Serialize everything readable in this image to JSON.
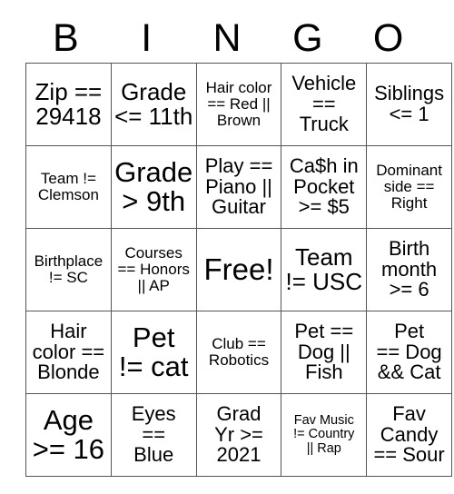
{
  "card": {
    "title_letters": [
      "B",
      "I",
      "N",
      "G",
      "O"
    ],
    "columns": 5,
    "rows": 5,
    "free_space": {
      "row": 2,
      "col": 2,
      "label": "Free!"
    },
    "cells": [
      [
        {
          "text": "Zip ==\n29418",
          "size": "lg"
        },
        {
          "text": "Grade\n<= 11th",
          "size": "lg"
        },
        {
          "text": "Hair color\n== Red ||\nBrown",
          "size": "sm"
        },
        {
          "text": "Vehicle\n==\nTruck",
          "size": "md"
        },
        {
          "text": "Siblings\n<= 1",
          "size": "md"
        }
      ],
      [
        {
          "text": "Team !=\nClemson",
          "size": "sm"
        },
        {
          "text": "Grade\n> 9th",
          "size": "xl"
        },
        {
          "text": "Play ==\nPiano ||\nGuitar",
          "size": "md"
        },
        {
          "text": "Ca$h in\nPocket\n>= $5",
          "size": "md"
        },
        {
          "text": "Dominant\nside ==\nRight",
          "size": "sm"
        }
      ],
      [
        {
          "text": "Birthplace\n!= SC",
          "size": "sm"
        },
        {
          "text": "Courses\n== Honors\n|| AP",
          "size": "sm"
        },
        {
          "text": "Free!",
          "size": "free"
        },
        {
          "text": "Team\n!= USC",
          "size": "lg"
        },
        {
          "text": "Birth\nmonth\n>= 6",
          "size": "md"
        }
      ],
      [
        {
          "text": "Hair\ncolor ==\nBlonde",
          "size": "md"
        },
        {
          "text": "Pet\n!= cat",
          "size": "xl"
        },
        {
          "text": "Club ==\nRobotics",
          "size": "sm"
        },
        {
          "text": "Pet ==\nDog ||\nFish",
          "size": "md"
        },
        {
          "text": "Pet\n== Dog\n&& Cat",
          "size": "md"
        }
      ],
      [
        {
          "text": "Age\n>= 16",
          "size": "xl"
        },
        {
          "text": "Eyes\n==\nBlue",
          "size": "md"
        },
        {
          "text": "Grad\nYr >=\n2021",
          "size": "md"
        },
        {
          "text": "Fav Music\n!= Country\n|| Rap",
          "size": "xs"
        },
        {
          "text": "Fav\nCandy\n== Sour",
          "size": "md"
        }
      ]
    ]
  },
  "colors": {
    "background": "#ffffff",
    "text": "#000000",
    "border": "#555555"
  }
}
